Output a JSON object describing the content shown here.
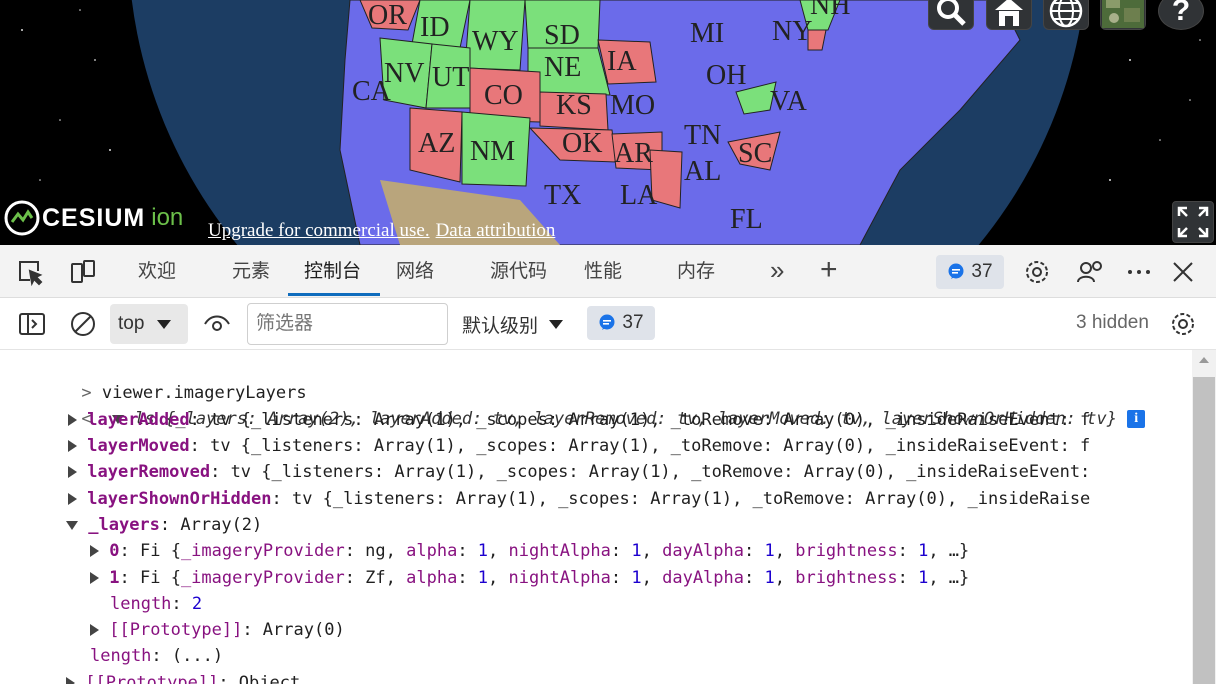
{
  "viewport": {
    "states": [
      {
        "label": "OR",
        "color": "#e8777a"
      },
      {
        "label": "ID",
        "color": "#7be07b"
      },
      {
        "label": "WY",
        "color": "#7be07b"
      },
      {
        "label": "SD",
        "color": "#7be07b"
      },
      {
        "label": "NE",
        "color": "#7be07b"
      },
      {
        "label": "IA",
        "color": "#e8777a"
      },
      {
        "label": "NV",
        "color": "#7be07b"
      },
      {
        "label": "UT",
        "color": "#7be07b"
      },
      {
        "label": "CO",
        "color": "#e8777a"
      },
      {
        "label": "KS",
        "color": "#e8777a"
      },
      {
        "label": "MO",
        "color": "#6b6bea"
      },
      {
        "label": "CA",
        "color": "#6b6bea"
      },
      {
        "label": "AZ",
        "color": "#e8777a"
      },
      {
        "label": "NM",
        "color": "#7be07b"
      },
      {
        "label": "OK",
        "color": "#e8777a"
      },
      {
        "label": "AR",
        "color": "#e8777a"
      },
      {
        "label": "TX",
        "color": "#6b6bea"
      },
      {
        "label": "LA",
        "color": "#6b6bea"
      },
      {
        "label": "AL",
        "color": "#6b6bea"
      },
      {
        "label": "TN",
        "color": "#6b6bea"
      },
      {
        "label": "SC",
        "color": "#e8777a"
      },
      {
        "label": "OH",
        "color": "#6b6bea"
      },
      {
        "label": "VA",
        "color": "#6b6bea"
      },
      {
        "label": "MI",
        "color": "#6b6bea"
      },
      {
        "label": "NY",
        "color": "#6b6bea"
      },
      {
        "label": "NH",
        "color": "#7be07b"
      },
      {
        "label": "FL",
        "color": "#6b6bea"
      }
    ],
    "credit_logo_text": "CESIUM",
    "credit_logo_suffix": "ion",
    "credit_links": [
      "Upgrade for commercial use.",
      "Data attribution"
    ],
    "toolbar_icons": [
      "search-icon",
      "home-icon",
      "globe-icon",
      "imagery-icon",
      "help-icon"
    ],
    "help_label": "?"
  },
  "devtools": {
    "tabs": [
      "欢迎",
      "元素",
      "控制台",
      "网络",
      "源代码",
      "性能",
      "内存"
    ],
    "active_tab": "控制台",
    "overflow_label": "»",
    "add_label": "+",
    "issues_count": "37",
    "filter": {
      "context": "top",
      "placeholder": "筛选器",
      "level": "默认级别",
      "issues_count": "37",
      "hidden_label": "3 hidden"
    },
    "console": {
      "input_prompt": ">",
      "input_command": "viewer.imageryLayers",
      "output_prompt": "<",
      "summary": "ls {_layers: Array(2), layerAdded: tv, layerRemoved: tv, layerMoved: tv, layerShownOrHidden: tv}",
      "rows": [
        {
          "key": "layerAdded",
          "value": "tv {_listeners: Array(1), _scopes: Array(1), _toRemove: Array(0), _insideRaiseEvent: f"
        },
        {
          "key": "layerMoved",
          "value": "tv {_listeners: Array(1), _scopes: Array(1), _toRemove: Array(0), _insideRaiseEvent: f"
        },
        {
          "key": "layerRemoved",
          "value": "tv {_listeners: Array(1), _scopes: Array(1), _toRemove: Array(0), _insideRaiseEvent:"
        },
        {
          "key": "layerShownOrHidden",
          "value": "tv {_listeners: Array(1), _scopes: Array(1), _toRemove: Array(0), _insideRaise"
        },
        {
          "key": "_layers",
          "value": "Array(2)"
        },
        {
          "key": "0",
          "value": "Fi {_imageryProvider: ng, alpha: 1, nightAlpha: 1, dayAlpha: 1, brightness: 1, …}"
        },
        {
          "key": "1",
          "value": "Fi {_imageryProvider: Zf, alpha: 1, nightAlpha: 1, dayAlpha: 1, brightness: 1, …}"
        },
        {
          "key": "length",
          "value": "2"
        },
        {
          "key": "[[Prototype]]",
          "value": "Array(0)"
        },
        {
          "key": "length",
          "value": "(...)"
        },
        {
          "key": "[[Prototype]]",
          "value": "Object"
        }
      ]
    }
  }
}
